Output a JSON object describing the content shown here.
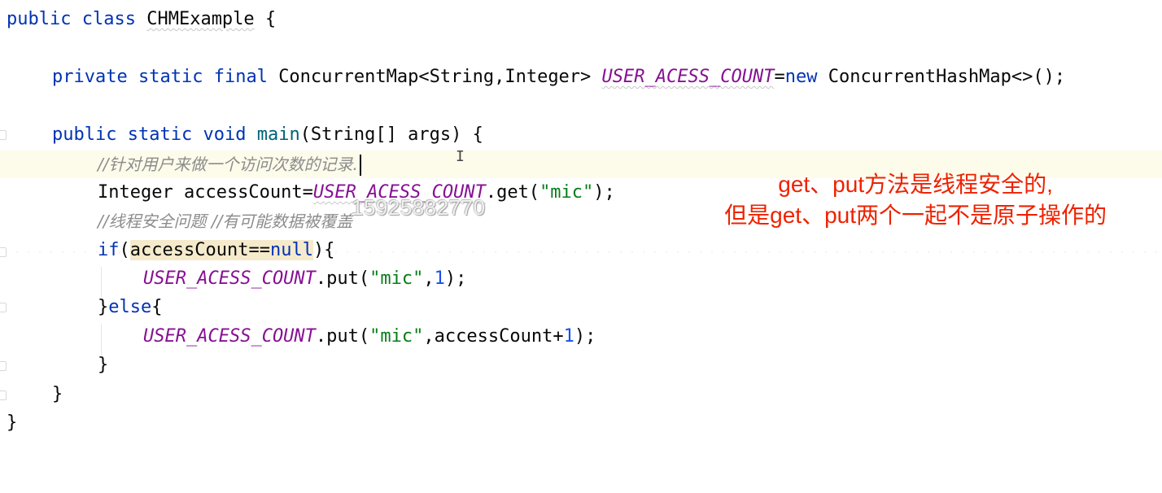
{
  "code": {
    "line1": {
      "kw_public": "public",
      "kw_class": "class",
      "class_name": "CHMExample",
      "brace": "{"
    },
    "line2": {
      "kw_private": "private",
      "kw_static": "static",
      "kw_final": "final",
      "type": "ConcurrentMap<String,Integer>",
      "field": "USER_ACESS_COUNT",
      "eq": "=",
      "kw_new": "new",
      "init": "ConcurrentHashMap<>();"
    },
    "line3": {
      "kw_public": "public",
      "kw_static": "static",
      "kw_void": "void",
      "method": "main",
      "params": "(String[] args) {"
    },
    "line4": {
      "comment": "//针对用户来做一个访问次数的记录."
    },
    "line5": {
      "decl": "Integer accessCount=",
      "field": "USER_ACESS_COUNT",
      "call_open": ".get(",
      "arg": "\"mic\"",
      "call_close": ");"
    },
    "line6": {
      "comment": "//线程安全问题 //有可能数据被覆盖"
    },
    "line7": {
      "kw_if": "if",
      "open": "(",
      "var": "accessCount",
      "eq": "==",
      "kw_null": "null",
      "close": "){"
    },
    "line8": {
      "field": "USER_ACESS_COUNT",
      "call_open": ".put(",
      "arg": "\"mic\"",
      "comma": ",",
      "num": "1",
      "call_close": ");"
    },
    "line9": {
      "close": "}",
      "kw_else": "else",
      "open": "{"
    },
    "line10": {
      "field": "USER_ACESS_COUNT",
      "call_open": ".put(",
      "arg": "\"mic\"",
      "mid": ",accessCount+",
      "num": "1",
      "call_close": ");"
    },
    "line11": {
      "brace": "}"
    },
    "line12": {
      "brace": "}"
    },
    "line13": {
      "brace": "}"
    }
  },
  "annotation": {
    "line1": "get、put方法是线程安全的,",
    "line2": "但是get、put两个一起不是原子操作的"
  },
  "watermark": "15925882770",
  "mouse_cursor": "I",
  "colors": {
    "keyword": "#0033b3",
    "field": "#871094",
    "string": "#067d17",
    "number": "#1750eb",
    "comment": "#8c8c8c",
    "annotation": "#ee2200",
    "current_line": "#fdfbea"
  }
}
